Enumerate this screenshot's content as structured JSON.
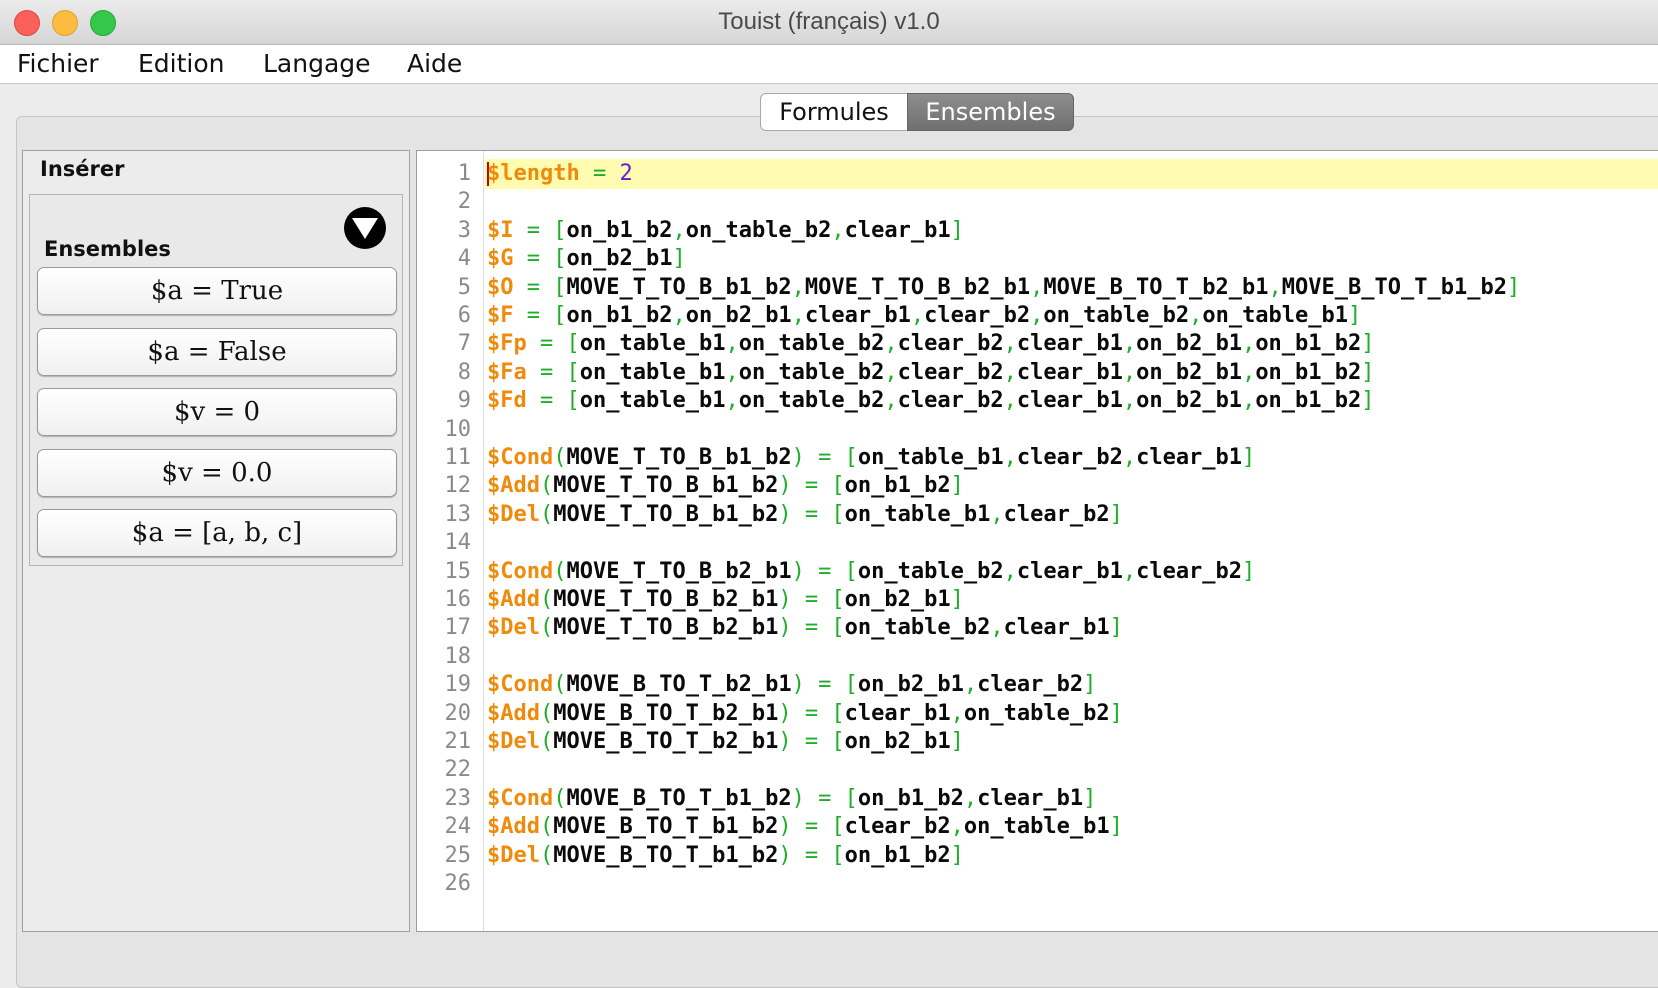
{
  "window": {
    "title": "Touist (français) v1.0"
  },
  "menu": [
    "Fichier",
    "Edition",
    "Langage",
    "Aide"
  ],
  "tabs": {
    "formules": "Formules",
    "ensembles": "Ensembles",
    "active": "Ensembles"
  },
  "left_panel": {
    "title": "Insérer",
    "section": "Ensembles",
    "collapse_icon": "collapse-down-icon",
    "buttons": [
      "$a = True",
      "$a = False",
      "$v = 0",
      "$v = 0.0",
      "$a = [a, b, c]"
    ]
  },
  "editor": {
    "current_line": 1,
    "lines": [
      "$length = 2",
      "",
      "$I = [on_b1_b2,on_table_b2,clear_b1]",
      "$G = [on_b2_b1]",
      "$O = [MOVE_T_TO_B_b1_b2,MOVE_T_TO_B_b2_b1,MOVE_B_TO_T_b2_b1,MOVE_B_TO_T_b1_b2]",
      "$F = [on_b1_b2,on_b2_b1,clear_b1,clear_b2,on_table_b2,on_table_b1]",
      "$Fp = [on_table_b1,on_table_b2,clear_b2,clear_b1,on_b2_b1,on_b1_b2]",
      "$Fa = [on_table_b1,on_table_b2,clear_b2,clear_b1,on_b2_b1,on_b1_b2]",
      "$Fd = [on_table_b1,on_table_b2,clear_b2,clear_b1,on_b2_b1,on_b1_b2]",
      "",
      "$Cond(MOVE_T_TO_B_b1_b2) = [on_table_b1,clear_b2,clear_b1]",
      "$Add(MOVE_T_TO_B_b1_b2) = [on_b1_b2]",
      "$Del(MOVE_T_TO_B_b1_b2) = [on_table_b1,clear_b2]",
      "",
      "$Cond(MOVE_T_TO_B_b2_b1) = [on_table_b2,clear_b1,clear_b2]",
      "$Add(MOVE_T_TO_B_b2_b1) = [on_b2_b1]",
      "$Del(MOVE_T_TO_B_b2_b1) = [on_table_b2,clear_b1]",
      "",
      "$Cond(MOVE_B_TO_T_b2_b1) = [on_b2_b1,clear_b2]",
      "$Add(MOVE_B_TO_T_b2_b1) = [clear_b1,on_table_b2]",
      "$Del(MOVE_B_TO_T_b2_b1) = [on_b2_b1]",
      "",
      "$Cond(MOVE_B_TO_T_b1_b2) = [on_b1_b2,clear_b1]",
      "$Add(MOVE_B_TO_T_b1_b2) = [clear_b2,on_table_b1]",
      "$Del(MOVE_B_TO_T_b1_b2) = [on_b1_b2]",
      ""
    ]
  },
  "colors": {
    "variable": "#ef8a0a",
    "operator": "#1fae28",
    "number": "#6a18d6",
    "identifier": "#0a0a0a",
    "current_line": "#fffbb0"
  }
}
